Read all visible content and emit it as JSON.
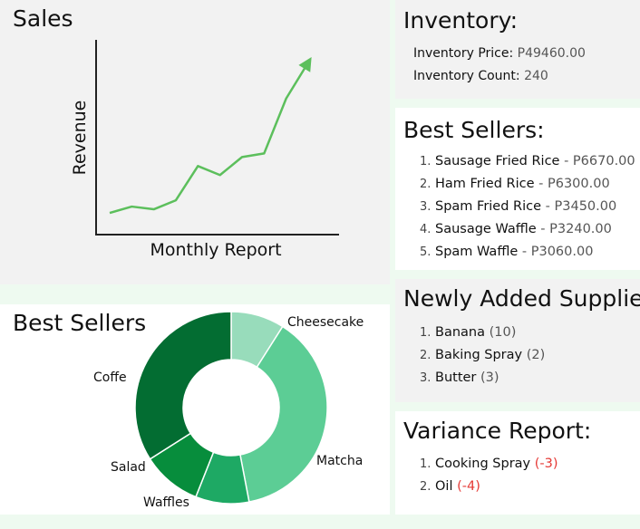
{
  "sales": {
    "title": "Sales",
    "chart_data": {
      "type": "line",
      "title": "",
      "xlabel": "Monthly Report",
      "ylabel": "Revenue",
      "x": [
        1,
        2,
        3,
        4,
        5,
        6,
        7,
        8,
        9,
        10
      ],
      "series": [
        {
          "values": [
            4,
            11,
            8,
            18,
            56,
            46,
            66,
            70,
            131,
            171
          ]
        }
      ],
      "ylim": [
        0,
        210
      ],
      "grid": false,
      "color": "#5cbf5c"
    }
  },
  "inventory": {
    "title": "Inventory:",
    "price_label": "Inventory Price:",
    "price_value": "P49460.00",
    "count_label": "Inventory Count:",
    "count_value": "240"
  },
  "best_sellers_list": {
    "title": "Best Sellers:",
    "items": [
      {
        "num": "1.",
        "name": "Sausage Fried Rice",
        "sep": " - ",
        "value": "P6670.00"
      },
      {
        "num": "2.",
        "name": "Ham Fried Rice",
        "sep": " - ",
        "value": "P6300.00"
      },
      {
        "num": "3.",
        "name": "Spam Fried Rice",
        "sep": " - ",
        "value": "P3450.00"
      },
      {
        "num": "4.",
        "name": "Sausage Waffle",
        "sep": " - ",
        "value": "P3240.00"
      },
      {
        "num": "5.",
        "name": "Spam Waffle",
        "sep": " - ",
        "value": "P3060.00"
      }
    ]
  },
  "best_sellers_chart": {
    "title": "Best Sellers",
    "chart_data": {
      "type": "pie",
      "donut": true,
      "slices": [
        {
          "label": "Cheesecake",
          "value": 9,
          "color": "#98dcbb"
        },
        {
          "label": "Matcha",
          "value": 38,
          "color": "#5ccd95"
        },
        {
          "label": "Waffles",
          "value": 9,
          "color": "#1ea964"
        },
        {
          "label": "Salad",
          "value": 10,
          "color": "#078d3c"
        },
        {
          "label": "Coffe",
          "value": 34,
          "color": "#036d32"
        }
      ]
    }
  },
  "supplies": {
    "title": "Newly Added Supplies:",
    "items": [
      {
        "num": "1.",
        "name": "Banana",
        "qty": "(10)"
      },
      {
        "num": "2.",
        "name": "Baking Spray",
        "qty": "(2)"
      },
      {
        "num": "3.",
        "name": "Butter",
        "qty": "(3)"
      }
    ]
  },
  "variance": {
    "title": "Variance Report:",
    "items": [
      {
        "num": "1.",
        "name": "Cooking Spray",
        "qty": "(-3)"
      },
      {
        "num": "2.",
        "name": "Oil",
        "qty": "(-4)"
      }
    ]
  }
}
